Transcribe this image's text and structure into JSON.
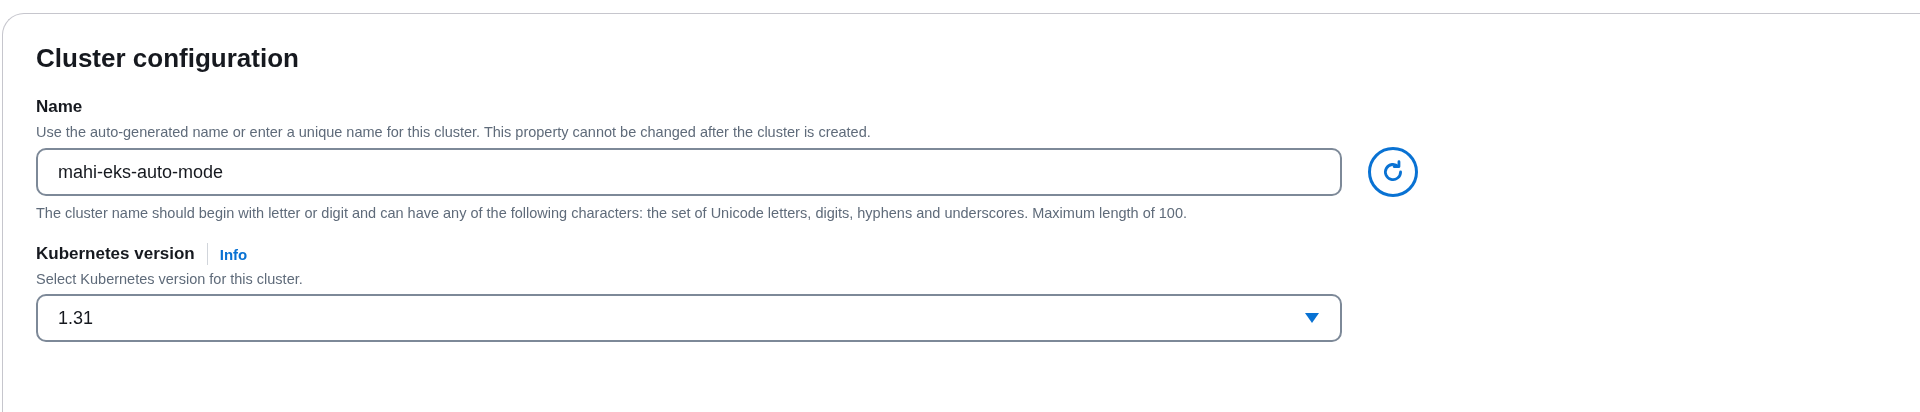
{
  "section": {
    "title": "Cluster configuration"
  },
  "name_field": {
    "label": "Name",
    "description": "Use the auto-generated name or enter a unique name for this cluster. This property cannot be changed after the cluster is created.",
    "value": "mahi-eks-auto-mode",
    "hint": "The cluster name should begin with letter or digit and can have any of the following characters: the set of Unicode letters, digits, hyphens and underscores. Maximum length of 100."
  },
  "version_field": {
    "label": "Kubernetes version",
    "info_link": "Info",
    "description": "Select Kubernetes version for this cluster.",
    "value": "1.31"
  }
}
